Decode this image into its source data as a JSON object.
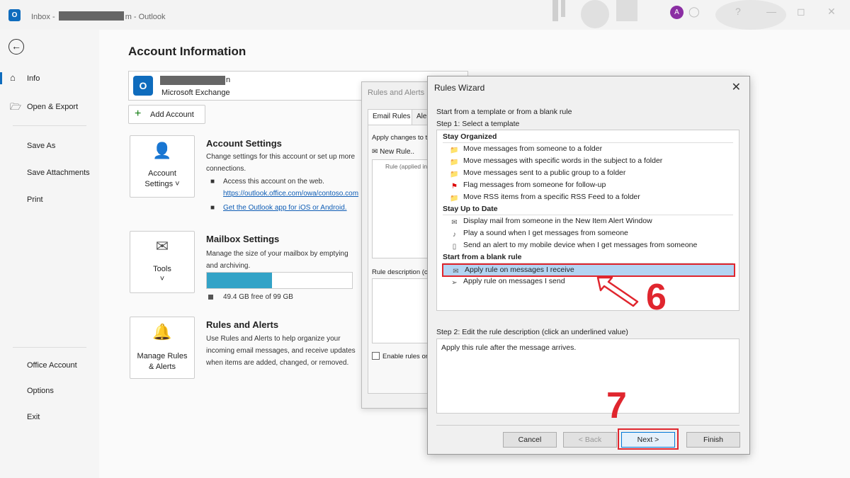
{
  "window": {
    "title_prefix": "Inbox - ",
    "title_suffix": "m - Outlook",
    "avatar_initial": "A"
  },
  "sidebar": {
    "items": [
      {
        "label": "Info",
        "icon": "home-icon"
      },
      {
        "label": "Open & Export",
        "icon": "folder-open-icon"
      },
      {
        "label": "Save As"
      },
      {
        "label": "Save Attachments"
      },
      {
        "label": "Print"
      },
      {
        "label": "Office Account"
      },
      {
        "label": "Options"
      },
      {
        "label": "Exit"
      }
    ]
  },
  "account": {
    "page_title": "Account Information",
    "name_tail": "n",
    "type": "Microsoft Exchange",
    "add_account": "Add Account"
  },
  "sections": {
    "account_settings": {
      "card_label": "Account Settings ˅",
      "title": "Account Settings",
      "desc": "Change settings for this account or set up more connections.",
      "bullet1": "Access this account on the web.",
      "link1": "https://outlook.office.com/owa/contoso.com",
      "link2": "Get the Outlook app for iOS or Android."
    },
    "mailbox_settings": {
      "card_label": "Tools",
      "title": "Mailbox Settings",
      "desc": "Manage the size of your mailbox by emptying and archiving.",
      "free_text": "49.4 GB free of 99 GB",
      "used_fraction": 0.45
    },
    "rules_alerts": {
      "card_label": "Manage Rules & Alerts",
      "title": "Rules and Alerts",
      "desc": "Use Rules and Alerts to help organize your incoming email messages, and receive updates when items are added, changed, or removed."
    }
  },
  "rules_dialog": {
    "title": "Rules and Alerts",
    "tab_email_rules": "Email Rules",
    "tab_alerts": "Alert",
    "apply_changes": "Apply changes to t",
    "new_rule": "New Rule..",
    "rule_col": "Rule (applied in t",
    "rule_desc": "Rule description (cli",
    "enable_rules": "Enable rules on"
  },
  "wizard": {
    "title": "Rules Wizard",
    "intro": "Start from a template or from a blank rule",
    "step1": "Step 1: Select a template",
    "groups": [
      {
        "name": "Stay Organized"
      },
      {
        "name": "Stay Up to Date"
      },
      {
        "name": "Start from a blank rule"
      }
    ],
    "templates": [
      "Move messages from someone to a folder",
      "Move messages with specific words in the subject to a folder",
      "Move messages sent to a public group to a folder",
      "Flag messages from someone for follow-up",
      "Move RSS items from a specific RSS Feed to a folder",
      "Display mail from someone in the New Item Alert Window",
      "Play a sound when I get messages from someone",
      "Send an alert to my mobile device when I get messages from someone",
      "Apply rule on messages I receive",
      "Apply rule on messages I send"
    ],
    "step2": "Step 2: Edit the rule description (click an underlined value)",
    "rule_description": "Apply this rule after the message arrives.",
    "buttons": {
      "cancel": "Cancel",
      "back": "< Back",
      "next": "Next >",
      "finish": "Finish"
    }
  },
  "annotations": {
    "step6": "6",
    "step7": "7",
    "color": "#e0262e"
  }
}
